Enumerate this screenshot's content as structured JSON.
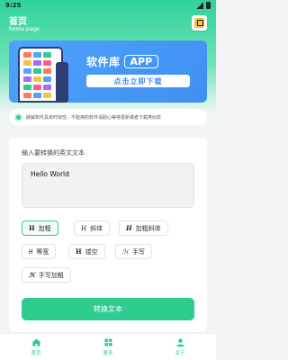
{
  "status_bar": {
    "time": "9:25"
  },
  "header": {
    "title": "首页",
    "subtitle": "home page"
  },
  "banner": {
    "title": "软件库",
    "app_tag": "APP",
    "cta": "点击立即下载"
  },
  "notice": {
    "text": "破解软件具有时效性，不能用的软件请耐心等待更新或者下载类似软"
  },
  "converter": {
    "input_label": "输入要转换的英文文本",
    "input_value": "Hello World",
    "styles": [
      {
        "glyph": "H",
        "label": "加粗"
      },
      {
        "glyph": "H",
        "label": "斜体"
      },
      {
        "glyph": "H",
        "label": "加粗斜体"
      },
      {
        "glyph": "H",
        "label": "等宽"
      },
      {
        "glyph": "H",
        "label": "镂空"
      },
      {
        "glyph": "ℋ",
        "label": "手写"
      },
      {
        "glyph": "ℋ",
        "label": "手写加粗"
      }
    ],
    "convert_button": "转换文本"
  },
  "tabbar": {
    "items": [
      {
        "label": "首页",
        "icon": "home-icon"
      },
      {
        "label": "更多",
        "icon": "grid-icon"
      },
      {
        "label": "关于",
        "icon": "user-icon"
      }
    ]
  },
  "colors": {
    "accent": "#2ecc8f",
    "banner": "#3f8ff0"
  }
}
